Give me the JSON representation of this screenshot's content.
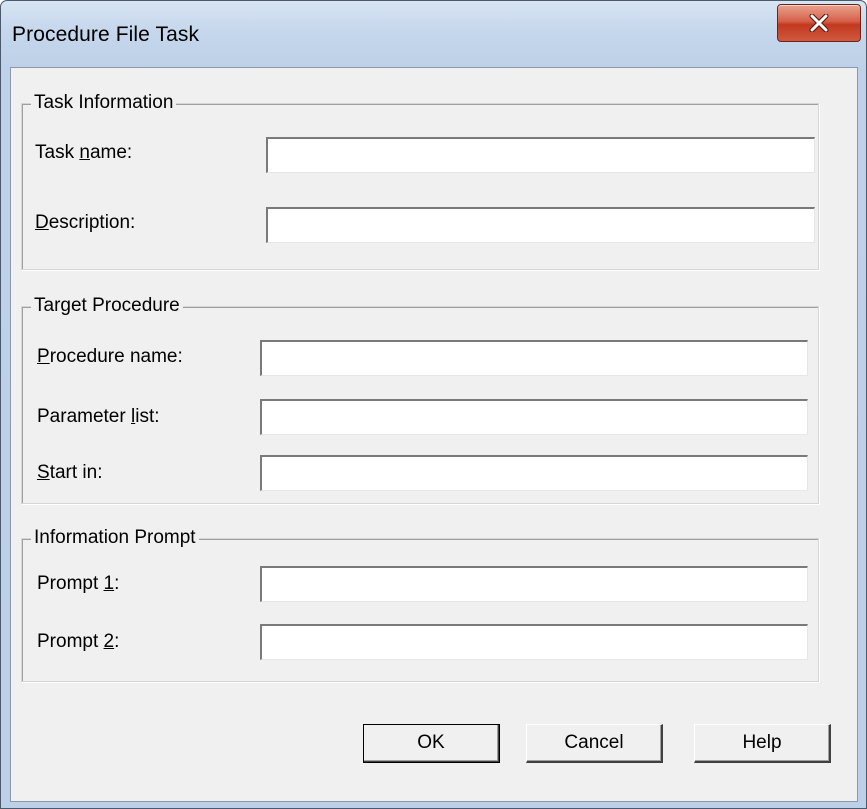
{
  "window": {
    "title": "Procedure File Task",
    "close_icon": "close-icon"
  },
  "task_information": {
    "legend": "Task Information",
    "task_name": {
      "label_pre": "Task ",
      "label_acc": "n",
      "label_post": "ame:",
      "value": ""
    },
    "description": {
      "label_pre": "",
      "label_acc": "D",
      "label_post": "escription:",
      "value": ""
    }
  },
  "target_procedure": {
    "legend": "Target Procedure",
    "procedure_name": {
      "label_pre": "",
      "label_acc": "P",
      "label_post": "rocedure name:",
      "value": ""
    },
    "parameter_list": {
      "label_pre": "Parameter ",
      "label_acc": "l",
      "label_post": "ist:",
      "value": ""
    },
    "start_in": {
      "label_pre": "",
      "label_acc": "S",
      "label_post": "tart in:",
      "value": ""
    }
  },
  "information_prompt": {
    "legend": "Information Prompt",
    "prompt1": {
      "label_pre": "Prompt ",
      "label_acc": "1",
      "label_post": ":",
      "value": ""
    },
    "prompt2": {
      "label_pre": "Prompt ",
      "label_acc": "2",
      "label_post": ":",
      "value": ""
    }
  },
  "buttons": {
    "ok": "OK",
    "cancel": "Cancel",
    "help": "Help"
  }
}
